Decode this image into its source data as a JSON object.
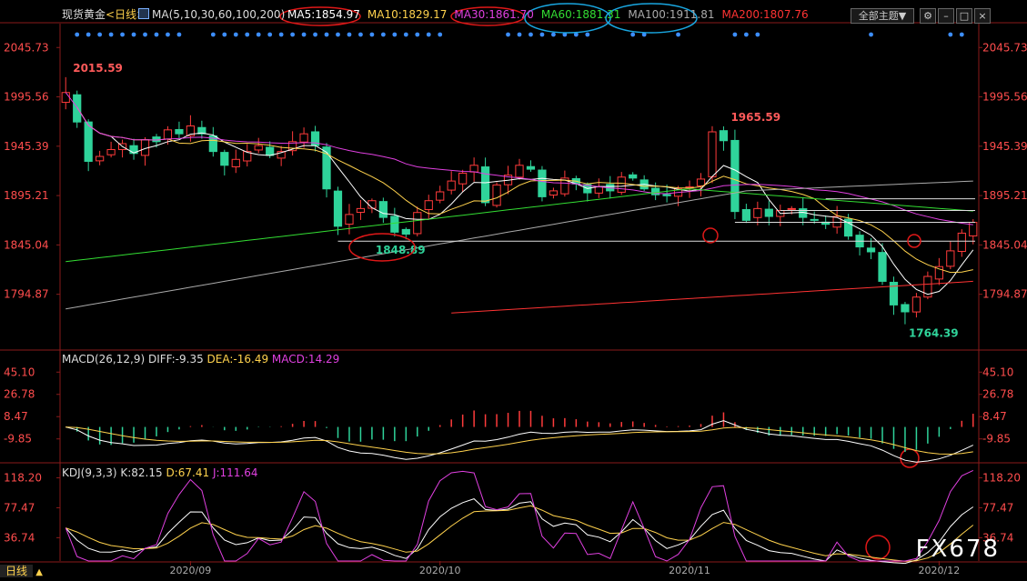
{
  "header": {
    "title": "现货黄金",
    "period": "<日线>",
    "ma_params": "MA(5,10,30,60,100,200)",
    "ma_values": [
      {
        "label": "MA5:1854.97",
        "color": "#ffffff"
      },
      {
        "label": "MA10:1829.17",
        "color": "#ffd24d"
      },
      {
        "label": "MA30:1861.70",
        "color": "#e040e0"
      },
      {
        "label": "MA60:1881.31",
        "color": "#33dd33"
      },
      {
        "label": "MA100:1911.81",
        "color": "#aaaaaa"
      },
      {
        "label": "MA200:1807.76",
        "color": "#ff3333"
      }
    ],
    "theme_button": "全部主题▼"
  },
  "macd_header": {
    "label": "MACD(26,12,9)",
    "diff": "DIFF:-9.35",
    "dea": "DEA:-16.49",
    "macd": "MACD:14.29"
  },
  "kdj_header": {
    "label": "KDJ(9,3,3)",
    "k": "K:82.15",
    "d": "D:67.41",
    "j": "J:111.64"
  },
  "bottom_left": "日线",
  "logo": "FX678",
  "chart_data": {
    "type": "candlestick",
    "main_ticks": [
      2045.73,
      1995.56,
      1945.39,
      1895.21,
      1845.04,
      1794.87
    ],
    "main_ylim": [
      1740,
      2070
    ],
    "macd_ticks": [
      45.1,
      26.78,
      8.47,
      -9.85
    ],
    "macd_ylim": [
      -28,
      58
    ],
    "kdj_ticks": [
      118.2,
      77.47,
      36.74
    ],
    "kdj_ylim": [
      5,
      130
    ],
    "x_labels": [
      {
        "text": "2020/09",
        "index": 11
      },
      {
        "text": "2020/10",
        "index": 33
      },
      {
        "text": "2020/11",
        "index": 55
      },
      {
        "text": "2020/12",
        "index": 77
      }
    ],
    "annotations": [
      {
        "text": "2015.59",
        "index": 0
      },
      {
        "text": "1965.59",
        "index": 58
      },
      {
        "text": "1848.89",
        "index": 27
      },
      {
        "text": "1764.39",
        "index": 74
      }
    ],
    "horizontal_lines": [
      1848.89,
      1868,
      1880,
      1892
    ],
    "n": 81,
    "closes": [
      2000,
      1970,
      1930,
      1935,
      1942,
      1948,
      1938,
      1952,
      1950,
      1962,
      1958,
      1966,
      1958,
      1940,
      1926,
      1932,
      1940,
      1946,
      1936,
      1940,
      1950,
      1958,
      1946,
      1902,
      1864,
      1876,
      1882,
      1890,
      1873,
      1858,
      1856,
      1878,
      1890,
      1899,
      1910,
      1918,
      1926,
      1888,
      1906,
      1916,
      1926,
      1922,
      1894,
      1900,
      1913,
      1907,
      1898,
      1904,
      1900,
      1914,
      1913,
      1902,
      1896,
      1895,
      1902,
      1904,
      1912,
      1960,
      1951,
      1879,
      1870,
      1882,
      1874,
      1880,
      1882,
      1873,
      1870,
      1866,
      1874,
      1854,
      1843,
      1838,
      1808,
      1784,
      1777,
      1792,
      1813,
      1823,
      1839,
      1857,
      1868,
      1874,
      1869,
      1871
    ],
    "chart_title": ""
  }
}
